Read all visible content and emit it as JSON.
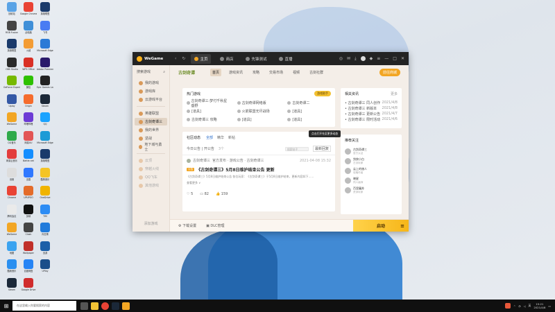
{
  "desktop_icons": [
    {
      "label": "回收站",
      "color": "#5aa3e6"
    },
    {
      "label": "Google Chrome",
      "color": "#e94335"
    },
    {
      "label": "英雄联盟",
      "color": "#1a3a6b"
    },
    {
      "label": "RGB Fusion",
      "color": "#444"
    },
    {
      "label": "此电脑",
      "color": "#3f8fd8"
    },
    {
      "label": "飞书",
      "color": "#4a7cf3"
    },
    {
      "label": "英雄联盟",
      "color": "#1a3a6b"
    },
    {
      "label": "火绒",
      "color": "#f39c34"
    },
    {
      "label": "Microsoft Edge",
      "color": "#2b7ad6"
    },
    {
      "label": "OBS Studio",
      "color": "#2a2a2a"
    },
    {
      "label": "WPS Office",
      "color": "#d93025"
    },
    {
      "label": "Adobe Premiere",
      "color": "#2a1a6b"
    },
    {
      "label": "GeForce Experience",
      "color": "#76b900"
    },
    {
      "label": "微信",
      "color": "#2dc100"
    },
    {
      "label": "Epic Games Launcher",
      "color": "#222"
    },
    {
      "label": "Uplay",
      "color": "#3458a5"
    },
    {
      "label": "Origin",
      "color": "#f56c2d"
    },
    {
      "label": "Steam",
      "color": "#1b2838"
    },
    {
      "label": "WeGame",
      "color": "#f2a624"
    },
    {
      "label": "哔哩哔哩",
      "color": "#6c3bd5"
    },
    {
      "label": "QQ",
      "color": "#1aa3ff"
    },
    {
      "label": "QQ音乐",
      "color": "#2faa4b"
    },
    {
      "label": "网易UU",
      "color": "#e25555"
    },
    {
      "label": "Microsoft Edge",
      "color": "#1c9bd6"
    },
    {
      "label": "网易云音乐",
      "color": "#e33d3d"
    },
    {
      "label": "Battle.net",
      "color": "#148eff"
    },
    {
      "label": "英雄联盟",
      "color": "#1a3a6b"
    },
    {
      "label": "设置",
      "color": "#ddd"
    },
    {
      "label": "迅雷",
      "color": "#2f78ff"
    },
    {
      "label": "酷狗音乐",
      "color": "#f4c425"
    },
    {
      "label": "Chrome",
      "color": "#e94335"
    },
    {
      "label": "UPUPOO",
      "color": "#e46c2a"
    },
    {
      "label": "OneDrive",
      "color": "#f0b400"
    },
    {
      "label": "腾讯会议",
      "color": "#eaeaea"
    },
    {
      "label": "剪映",
      "color": "#111"
    },
    {
      "label": "TIM",
      "color": "#2c8cf4"
    },
    {
      "label": "WeGame",
      "color": "#f2a624"
    },
    {
      "label": "Clash",
      "color": "#444"
    },
    {
      "label": "向日葵",
      "color": "#1f7adb"
    },
    {
      "label": "地图",
      "color": "#3aa3f0"
    },
    {
      "label": "Wallpaper",
      "color": "#c0302a"
    },
    {
      "label": "迅游",
      "color": "#1b5fa8"
    },
    {
      "label": "酷我音乐",
      "color": "#2a8ff0"
    },
    {
      "label": "百度网盘",
      "color": "#2684f5"
    },
    {
      "label": "UPlay",
      "color": "#1b4e8a"
    },
    {
      "label": "Steam",
      "color": "#1b2838"
    },
    {
      "label": "Google Drive",
      "color": "#d02c2c"
    }
  ],
  "window": {
    "app_name": "WeGame",
    "tabs": [
      {
        "label": "主页",
        "active": true
      },
      {
        "label": "商店",
        "active": false
      },
      {
        "label": "先锋测试",
        "active": false
      },
      {
        "label": "直播",
        "active": false
      }
    ],
    "sidebar": {
      "header": "搜索游戏",
      "items": [
        {
          "label": "我的游戏",
          "active": false,
          "dim": false
        },
        {
          "label": "游戏库",
          "active": false,
          "dim": false
        },
        {
          "label": "云游戏平台",
          "active": false,
          "dim": false
        },
        {
          "label": "英雄联盟",
          "active": false,
          "dim": false
        },
        {
          "label": "古剑奇谭三",
          "active": true,
          "dim": false
        },
        {
          "label": "我的世界",
          "active": false,
          "dim": false
        },
        {
          "label": "逆战",
          "active": false,
          "dim": false
        },
        {
          "label": "地下城与勇士",
          "active": false,
          "dim": false
        },
        {
          "label": "云顶",
          "active": false,
          "dim": true
        },
        {
          "label": "穿越火线",
          "active": false,
          "dim": true
        },
        {
          "label": "QQ飞车",
          "active": false,
          "dim": true
        },
        {
          "label": "其他游戏",
          "active": false,
          "dim": true
        }
      ],
      "footer": "添加游戏"
    },
    "game_header": {
      "logo": "古剑奇谭",
      "tabs": [
        "首页",
        "游戏资讯",
        "攻略",
        "交易市场",
        "视频",
        "古剑社群"
      ],
      "active_tab": "首页",
      "action_button": "前往商城"
    },
    "hot_card": {
      "title": "热门游戏",
      "badge": "游戏助手",
      "cells": [
        "古剑奇谭三:梦付千秋星垂野",
        "古剑奇谭网络版",
        "古剑奇谭二",
        "[道具]",
        "火箭联盟无尽战场",
        "[道具]",
        "古剑奇谭三 攻略",
        "[道具]",
        "[道具]"
      ]
    },
    "related_card": {
      "title": "相关资讯",
      "more": "更多",
      "rows": [
        {
          "text": "古剑奇谭三 同人创作",
          "date": "2021/4/8"
        },
        {
          "text": "古剑奇谭三 新版本",
          "date": "2021/4/8"
        },
        {
          "text": "古剑奇谭三 更新公告",
          "date": "2021/4/7"
        },
        {
          "text": "古剑奇谭三 限时活动",
          "date": "2021/4/6"
        }
      ]
    },
    "feed": {
      "title": "社区动态",
      "tabs": [
        "全部",
        "精华",
        "新帖"
      ],
      "tooltip": "点击打开社区更多动态",
      "filter_label": "今日公告 | 开公告",
      "filter_count": "3个",
      "search_placeholder": "搜索帖子",
      "sort": "最新回复",
      "post": {
        "author": "古剑奇谭三",
        "meta": "官方发布 · 游戏公告 · 古剑奇谭三",
        "time": "2021-04-08 15:32",
        "tag": "公告",
        "title": "《古剑奇谭三》5月8日维护结束公告 更新",
        "summary": "《古剑奇谭三》5月8日维护结束公告 各位玩家：《古剑奇谭三》于5月8日维护结束，更新内容如下……",
        "more": "查看更多 ∨",
        "likes": "5",
        "comments": "82",
        "views": "159"
      }
    },
    "follow_card": {
      "title": "推荐关注",
      "users": [
        {
          "name": "古剑奇谭三",
          "sub": "官方认证"
        },
        {
          "name": "剑侠小白",
          "sub": "古剑玩家"
        },
        {
          "name": "云上的旅人",
          "sub": "攻略作者"
        },
        {
          "name": "晓星",
          "sub": "同人画师"
        },
        {
          "name": "百里屠苏",
          "sub": "资深玩家"
        }
      ]
    },
    "bottom": {
      "download_settings": "下载设置",
      "dlc_manage": "DLC管理",
      "launch": "启动"
    }
  },
  "taskbar": {
    "search_placeholder": "在这里输入你要搜索的内容",
    "time": "15:21",
    "date": "2021/4/8",
    "ime": "英"
  }
}
